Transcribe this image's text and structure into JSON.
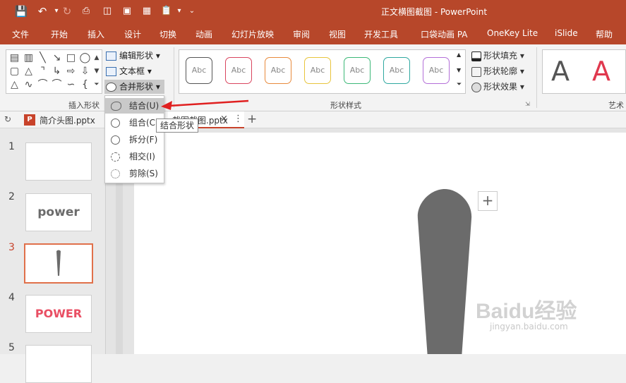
{
  "window": {
    "title": "正文横图截图  -  PowerPoint"
  },
  "quick_access": {
    "save": "save-icon",
    "undo": "undo-icon",
    "redo": "redo-icon"
  },
  "tabs": [
    "文件",
    "开始",
    "插入",
    "设计",
    "切换",
    "动画",
    "幻灯片放映",
    "审阅",
    "视图",
    "开发工具",
    "口袋动画 PA",
    "OneKey Lite",
    "iSlide",
    "帮助"
  ],
  "ribbon": {
    "insert_shapes_label": "插入形状",
    "edit_shape": "编辑形状",
    "text_box": "文本框",
    "merge_shapes": "合并形状",
    "shape_styles_label": "形状样式",
    "style_sample_text": "Abc",
    "shape_fill": "形状填充",
    "shape_outline": "形状轮廓",
    "shape_effect": "形状效果",
    "wordart_label": "艺术",
    "wordart_letter": "A"
  },
  "merge_menu": {
    "items": [
      "结合(U)",
      "组合(C)",
      "拆分(F)",
      "相交(I)",
      "剪除(S)"
    ]
  },
  "tooltip": "结合形状",
  "file_tab": {
    "name": "简介头图.pptx"
  },
  "doc_tab": {
    "name": "截图截图.pptx"
  },
  "slides": [
    {
      "num": "1",
      "text": ""
    },
    {
      "num": "2",
      "text": "power"
    },
    {
      "num": "3",
      "text": ""
    },
    {
      "num": "4",
      "text": "POWER"
    },
    {
      "num": "5",
      "text": ""
    }
  ],
  "colors": {
    "accent": "#b7472a",
    "selected_slide": "#e0704a",
    "shape_gray": "#6b6b6b"
  },
  "watermark": {
    "logo": "Baidu经验",
    "url": "jingyan.baidu.com"
  }
}
